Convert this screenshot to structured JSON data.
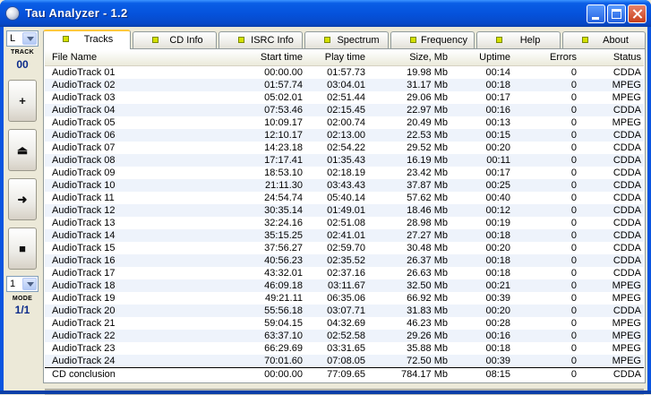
{
  "window": {
    "title": "Tau Analyzer - 1.2"
  },
  "left_toolbar": {
    "track_combo_value": "L",
    "track_label": "TRACK",
    "track_number": "00",
    "buttons": [
      {
        "name": "add-button",
        "glyph": "+"
      },
      {
        "name": "eject-button",
        "glyph": "⏏"
      },
      {
        "name": "next-button",
        "glyph": "➜"
      },
      {
        "name": "stop-button",
        "glyph": "■"
      }
    ],
    "mode_combo_value": "1",
    "mode_label": "MODE",
    "mode_value": "1/1"
  },
  "tabs": [
    {
      "label": "Tracks",
      "active": true
    },
    {
      "label": "CD Info",
      "active": false
    },
    {
      "label": "ISRC Info",
      "active": false
    },
    {
      "label": "Spectrum",
      "active": false
    },
    {
      "label": "Frequency",
      "active": false
    },
    {
      "label": "Help",
      "active": false
    },
    {
      "label": "About",
      "active": false
    }
  ],
  "table": {
    "columns": [
      "File Name",
      "Start time",
      "Play time",
      "Size, Mb",
      "Uptime",
      "Errors",
      "Status"
    ],
    "rows": [
      [
        "AudioTrack 01",
        "00:00.00",
        "01:57.73",
        "19.98 Mb",
        "00:14",
        "0",
        "CDDA"
      ],
      [
        "AudioTrack 02",
        "01:57.74",
        "03:04.01",
        "31.17 Mb",
        "00:18",
        "0",
        "MPEG"
      ],
      [
        "AudioTrack 03",
        "05:02.01",
        "02:51.44",
        "29.06 Mb",
        "00:17",
        "0",
        "MPEG"
      ],
      [
        "AudioTrack 04",
        "07:53.46",
        "02:15.45",
        "22.97 Mb",
        "00:16",
        "0",
        "CDDA"
      ],
      [
        "AudioTrack 05",
        "10:09.17",
        "02:00.74",
        "20.49 Mb",
        "00:13",
        "0",
        "MPEG"
      ],
      [
        "AudioTrack 06",
        "12:10.17",
        "02:13.00",
        "22.53 Mb",
        "00:15",
        "0",
        "CDDA"
      ],
      [
        "AudioTrack 07",
        "14:23.18",
        "02:54.22",
        "29.52 Mb",
        "00:20",
        "0",
        "CDDA"
      ],
      [
        "AudioTrack 08",
        "17:17.41",
        "01:35.43",
        "16.19 Mb",
        "00:11",
        "0",
        "CDDA"
      ],
      [
        "AudioTrack 09",
        "18:53.10",
        "02:18.19",
        "23.42 Mb",
        "00:17",
        "0",
        "CDDA"
      ],
      [
        "AudioTrack 10",
        "21:11.30",
        "03:43.43",
        "37.87 Mb",
        "00:25",
        "0",
        "CDDA"
      ],
      [
        "AudioTrack 11",
        "24:54.74",
        "05:40.14",
        "57.62 Mb",
        "00:40",
        "0",
        "CDDA"
      ],
      [
        "AudioTrack 12",
        "30:35.14",
        "01:49.01",
        "18.46 Mb",
        "00:12",
        "0",
        "CDDA"
      ],
      [
        "AudioTrack 13",
        "32:24.16",
        "02:51.08",
        "28.98 Mb",
        "00:19",
        "0",
        "CDDA"
      ],
      [
        "AudioTrack 14",
        "35:15.25",
        "02:41.01",
        "27.27 Mb",
        "00:18",
        "0",
        "CDDA"
      ],
      [
        "AudioTrack 15",
        "37:56.27",
        "02:59.70",
        "30.48 Mb",
        "00:20",
        "0",
        "CDDA"
      ],
      [
        "AudioTrack 16",
        "40:56.23",
        "02:35.52",
        "26.37 Mb",
        "00:18",
        "0",
        "CDDA"
      ],
      [
        "AudioTrack 17",
        "43:32.01",
        "02:37.16",
        "26.63 Mb",
        "00:18",
        "0",
        "CDDA"
      ],
      [
        "AudioTrack 18",
        "46:09.18",
        "03:11.67",
        "32.50 Mb",
        "00:21",
        "0",
        "MPEG"
      ],
      [
        "AudioTrack 19",
        "49:21.11",
        "06:35.06",
        "66.92 Mb",
        "00:39",
        "0",
        "MPEG"
      ],
      [
        "AudioTrack 20",
        "55:56.18",
        "03:07.71",
        "31.83 Mb",
        "00:20",
        "0",
        "CDDA"
      ],
      [
        "AudioTrack 21",
        "59:04.15",
        "04:32.69",
        "46.23 Mb",
        "00:28",
        "0",
        "MPEG"
      ],
      [
        "AudioTrack 22",
        "63:37.10",
        "02:52.58",
        "29.26 Mb",
        "00:16",
        "0",
        "MPEG"
      ],
      [
        "AudioTrack 23",
        "66:29.69",
        "03:31.65",
        "35.88 Mb",
        "00:18",
        "0",
        "MPEG"
      ],
      [
        "AudioTrack 24",
        "70:01.60",
        "07:08.05",
        "72.50 Mb",
        "00:39",
        "0",
        "MPEG"
      ]
    ],
    "total": [
      "CD conclusion",
      "00:00.00",
      "77:09.65",
      "784.17 Mb",
      "08:15",
      "0",
      "CDDA"
    ]
  }
}
